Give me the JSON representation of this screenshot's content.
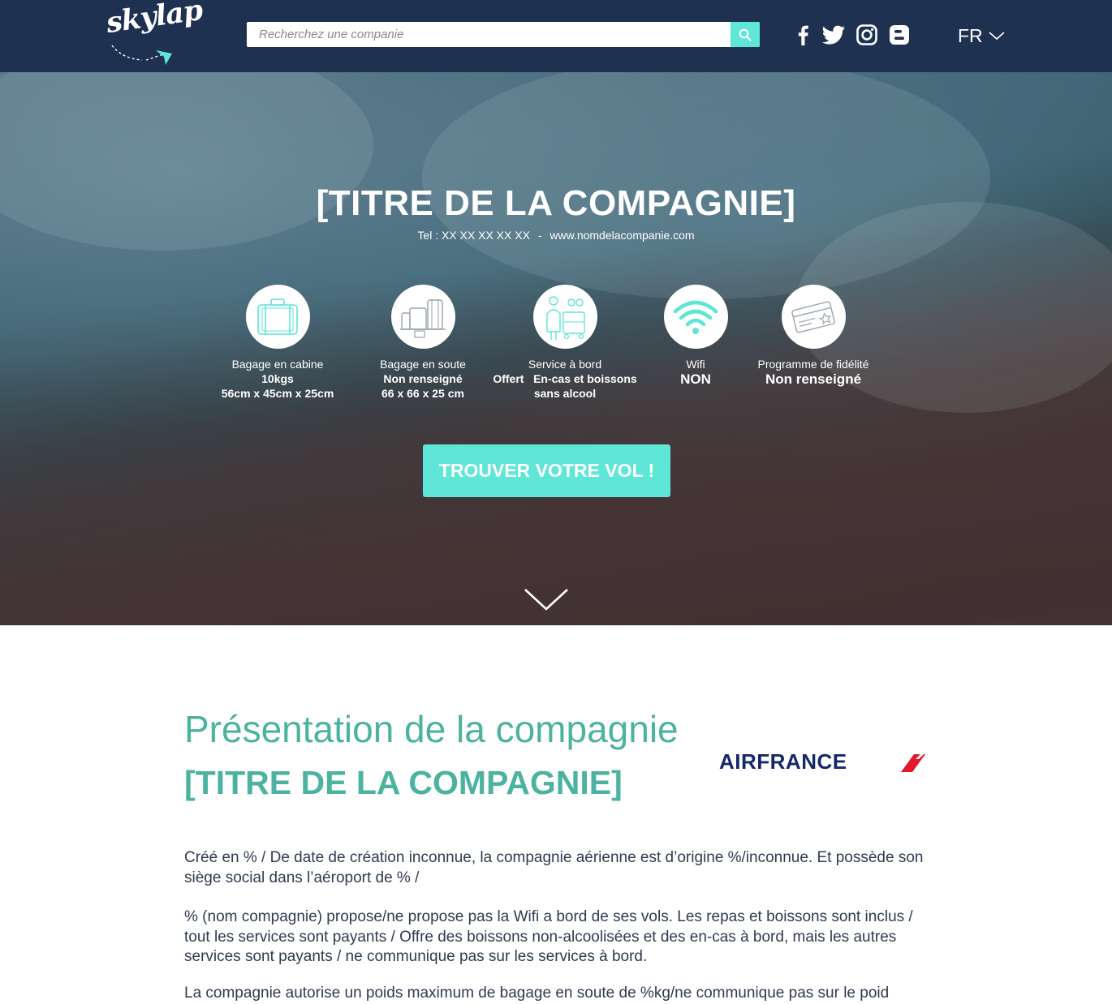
{
  "header": {
    "logo_text": "skylap",
    "search_placeholder": "Recherchez une companie",
    "search_icon": "search-icon",
    "social": [
      {
        "name": "facebook",
        "icon": "facebook-icon"
      },
      {
        "name": "twitter",
        "icon": "twitter-icon"
      },
      {
        "name": "instagram",
        "icon": "instagram-icon"
      },
      {
        "name": "blogger",
        "icon": "blogger-icon"
      }
    ],
    "language": "FR"
  },
  "hero": {
    "title": "[TITRE DE LA COMPAGNIE]",
    "tel": "Tel : XX XX XX XX XX",
    "separator": "-",
    "website": "www.nomdelacompanie.com",
    "features": [
      {
        "label": "Bagage en cabine",
        "value1": "10kgs",
        "value2": "56cm x 45cm x 25cm",
        "icon": "cabin-luggage-icon"
      },
      {
        "label": "Bagage en soute",
        "value1": "Non renseigné",
        "value2": "66 x 66 x 25 cm",
        "icon": "checked-luggage-icon"
      },
      {
        "label": "Service à bord",
        "value1": "Offert   En-cas et boissons",
        "value2": "sans alcool",
        "icon": "onboard-service-icon"
      },
      {
        "label": "Wifi",
        "value1": "NON",
        "icon": "wifi-icon"
      },
      {
        "label": "Programme de fidélité",
        "value1": "Non renseigné",
        "icon": "loyalty-card-icon"
      }
    ],
    "cta": "TROUVER VOTRE VOL !"
  },
  "content": {
    "title": "Présentation de la compagnie",
    "subtitle": "[TITRE DE LA COMPAGNIE]",
    "airline_logo_text": "AIRFRANCE",
    "paragraphs": [
      "Créé en % / De date de création inconnue, la compagnie aérienne est d’origine %/inconnue. Et possède son siège social dans l’aéroport de % /",
      "% (nom compagnie) propose/ne propose pas la Wifi a bord de ses vols. Les repas et boissons sont inclus / tout les services sont payants / Offre des boissons non-alcoolisées et des en-cas à bord, mais les autres services sont payants / ne communique pas sur les services à bord.",
      "La compagnie autorise un poids maximum de bagage en soute de %kg/ne communique pas sur le poid"
    ]
  },
  "colors": {
    "header_bg": "#1f3150",
    "accent": "#5ee6d6",
    "title_green": "#4db3a1",
    "body_text": "#2f3b4f",
    "airfrance_blue": "#14276b",
    "airfrance_red": "#e3192b"
  }
}
